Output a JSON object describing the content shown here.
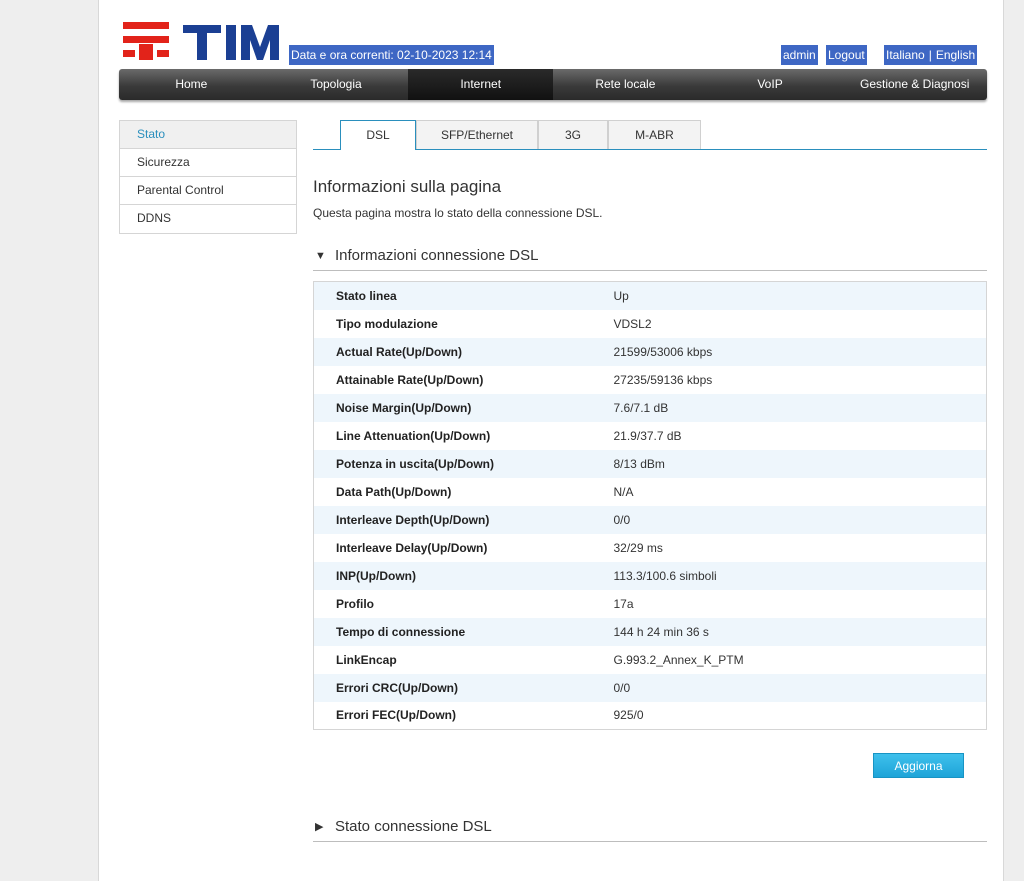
{
  "header": {
    "brand": "TIM",
    "datetime": "Data e ora correnti: 02-10-2023 12:14",
    "admin": "admin",
    "logout": "Logout",
    "lang_it": "Italiano",
    "lang_sep": "|",
    "lang_en": "English"
  },
  "mainnav": [
    {
      "label": "Home"
    },
    {
      "label": "Topologia"
    },
    {
      "label": "Internet"
    },
    {
      "label": "Rete locale"
    },
    {
      "label": "VoIP"
    },
    {
      "label": "Gestione & Diagnosi"
    }
  ],
  "sidebar": [
    {
      "label": "Stato"
    },
    {
      "label": "Sicurezza"
    },
    {
      "label": "Parental Control"
    },
    {
      "label": "DDNS"
    }
  ],
  "tabs": [
    {
      "label": "DSL"
    },
    {
      "label": "SFP/Ethernet"
    },
    {
      "label": "3G"
    },
    {
      "label": "M-ABR"
    }
  ],
  "page": {
    "title": "Informazioni sulla pagina",
    "description": "Questa pagina mostra lo stato della connessione DSL."
  },
  "section_info": {
    "icon": "triangle-down-icon",
    "title": "Informazioni connessione DSL"
  },
  "rows": [
    {
      "label": "Stato linea",
      "value": "Up"
    },
    {
      "label": "Tipo modulazione",
      "value": "VDSL2"
    },
    {
      "label": "Actual Rate(Up/Down)",
      "value": "21599/53006 kbps"
    },
    {
      "label": "Attainable Rate(Up/Down)",
      "value": "27235/59136 kbps"
    },
    {
      "label": "Noise Margin(Up/Down)",
      "value": "7.6/7.1 dB"
    },
    {
      "label": "Line Attenuation(Up/Down)",
      "value": "21.9/37.7 dB"
    },
    {
      "label": "Potenza in uscita(Up/Down)",
      "value": "8/13 dBm"
    },
    {
      "label": "Data Path(Up/Down)",
      "value": "N/A"
    },
    {
      "label": "Interleave Depth(Up/Down)",
      "value": "0/0"
    },
    {
      "label": "Interleave Delay(Up/Down)",
      "value": "32/29 ms"
    },
    {
      "label": "INP(Up/Down)",
      "value": "113.3/100.6 simboli"
    },
    {
      "label": "Profilo",
      "value": "17a"
    },
    {
      "label": "Tempo di connessione",
      "value": "144 h 24 min 36 s"
    },
    {
      "label": "LinkEncap",
      "value": "G.993.2_Annex_K_PTM"
    },
    {
      "label": "Errori CRC(Up/Down)",
      "value": "0/0"
    },
    {
      "label": "Errori FEC(Up/Down)",
      "value": "925/0"
    }
  ],
  "refresh_button": "Aggiorna",
  "section_status": {
    "icon": "triangle-right-icon",
    "title": "Stato connessione DSL"
  },
  "colors": {
    "accent": "#2a8fbd",
    "highlight_bg": "#3e67c4",
    "tim_red": "#e2231a",
    "tim_blue": "#1b3f93",
    "row_alt": "#eef6fc",
    "button": "#22abdf"
  }
}
